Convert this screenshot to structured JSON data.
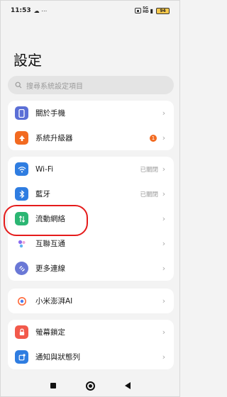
{
  "status_bar": {
    "time": "11:53",
    "notif_icons": "☁ ⋯",
    "net_top": "5G",
    "net_bottom": "HD",
    "battery": "94"
  },
  "page": {
    "title": "設定"
  },
  "search": {
    "placeholder": "搜尋系統設定項目"
  },
  "groups": [
    {
      "items": [
        {
          "label": "關於手機",
          "icon": "phone-icon",
          "color": "#5b6fd6"
        },
        {
          "label": "系統升級器",
          "icon": "upgrade-arrow-icon",
          "color": "#f26a21",
          "badge": "1"
        }
      ]
    },
    {
      "items": [
        {
          "label": "Wi-Fi",
          "icon": "wifi-icon",
          "color": "#2f7de1",
          "value": "已關閉"
        },
        {
          "label": "藍牙",
          "icon": "bluetooth-icon",
          "color": "#2f7de1",
          "value": "已關閉"
        },
        {
          "label": "流動網絡",
          "icon": "mobile-data-icon",
          "color": "#2bb673"
        },
        {
          "label": "互聯互通",
          "icon": "interconnect-icon",
          "color": "#8a6cf0"
        },
        {
          "label": "更多連線",
          "icon": "more-connection-icon",
          "color": "#6a78d6"
        }
      ]
    },
    {
      "items": [
        {
          "label": "小米澎湃AI",
          "icon": "hyperai-icon",
          "color": "#ff6a3d"
        }
      ]
    },
    {
      "items": [
        {
          "label": "螢幕鎖定",
          "icon": "lock-icon",
          "color": "#f2594b"
        },
        {
          "label": "通知與狀態列",
          "icon": "notification-icon",
          "color": "#2f7de1"
        }
      ]
    }
  ]
}
